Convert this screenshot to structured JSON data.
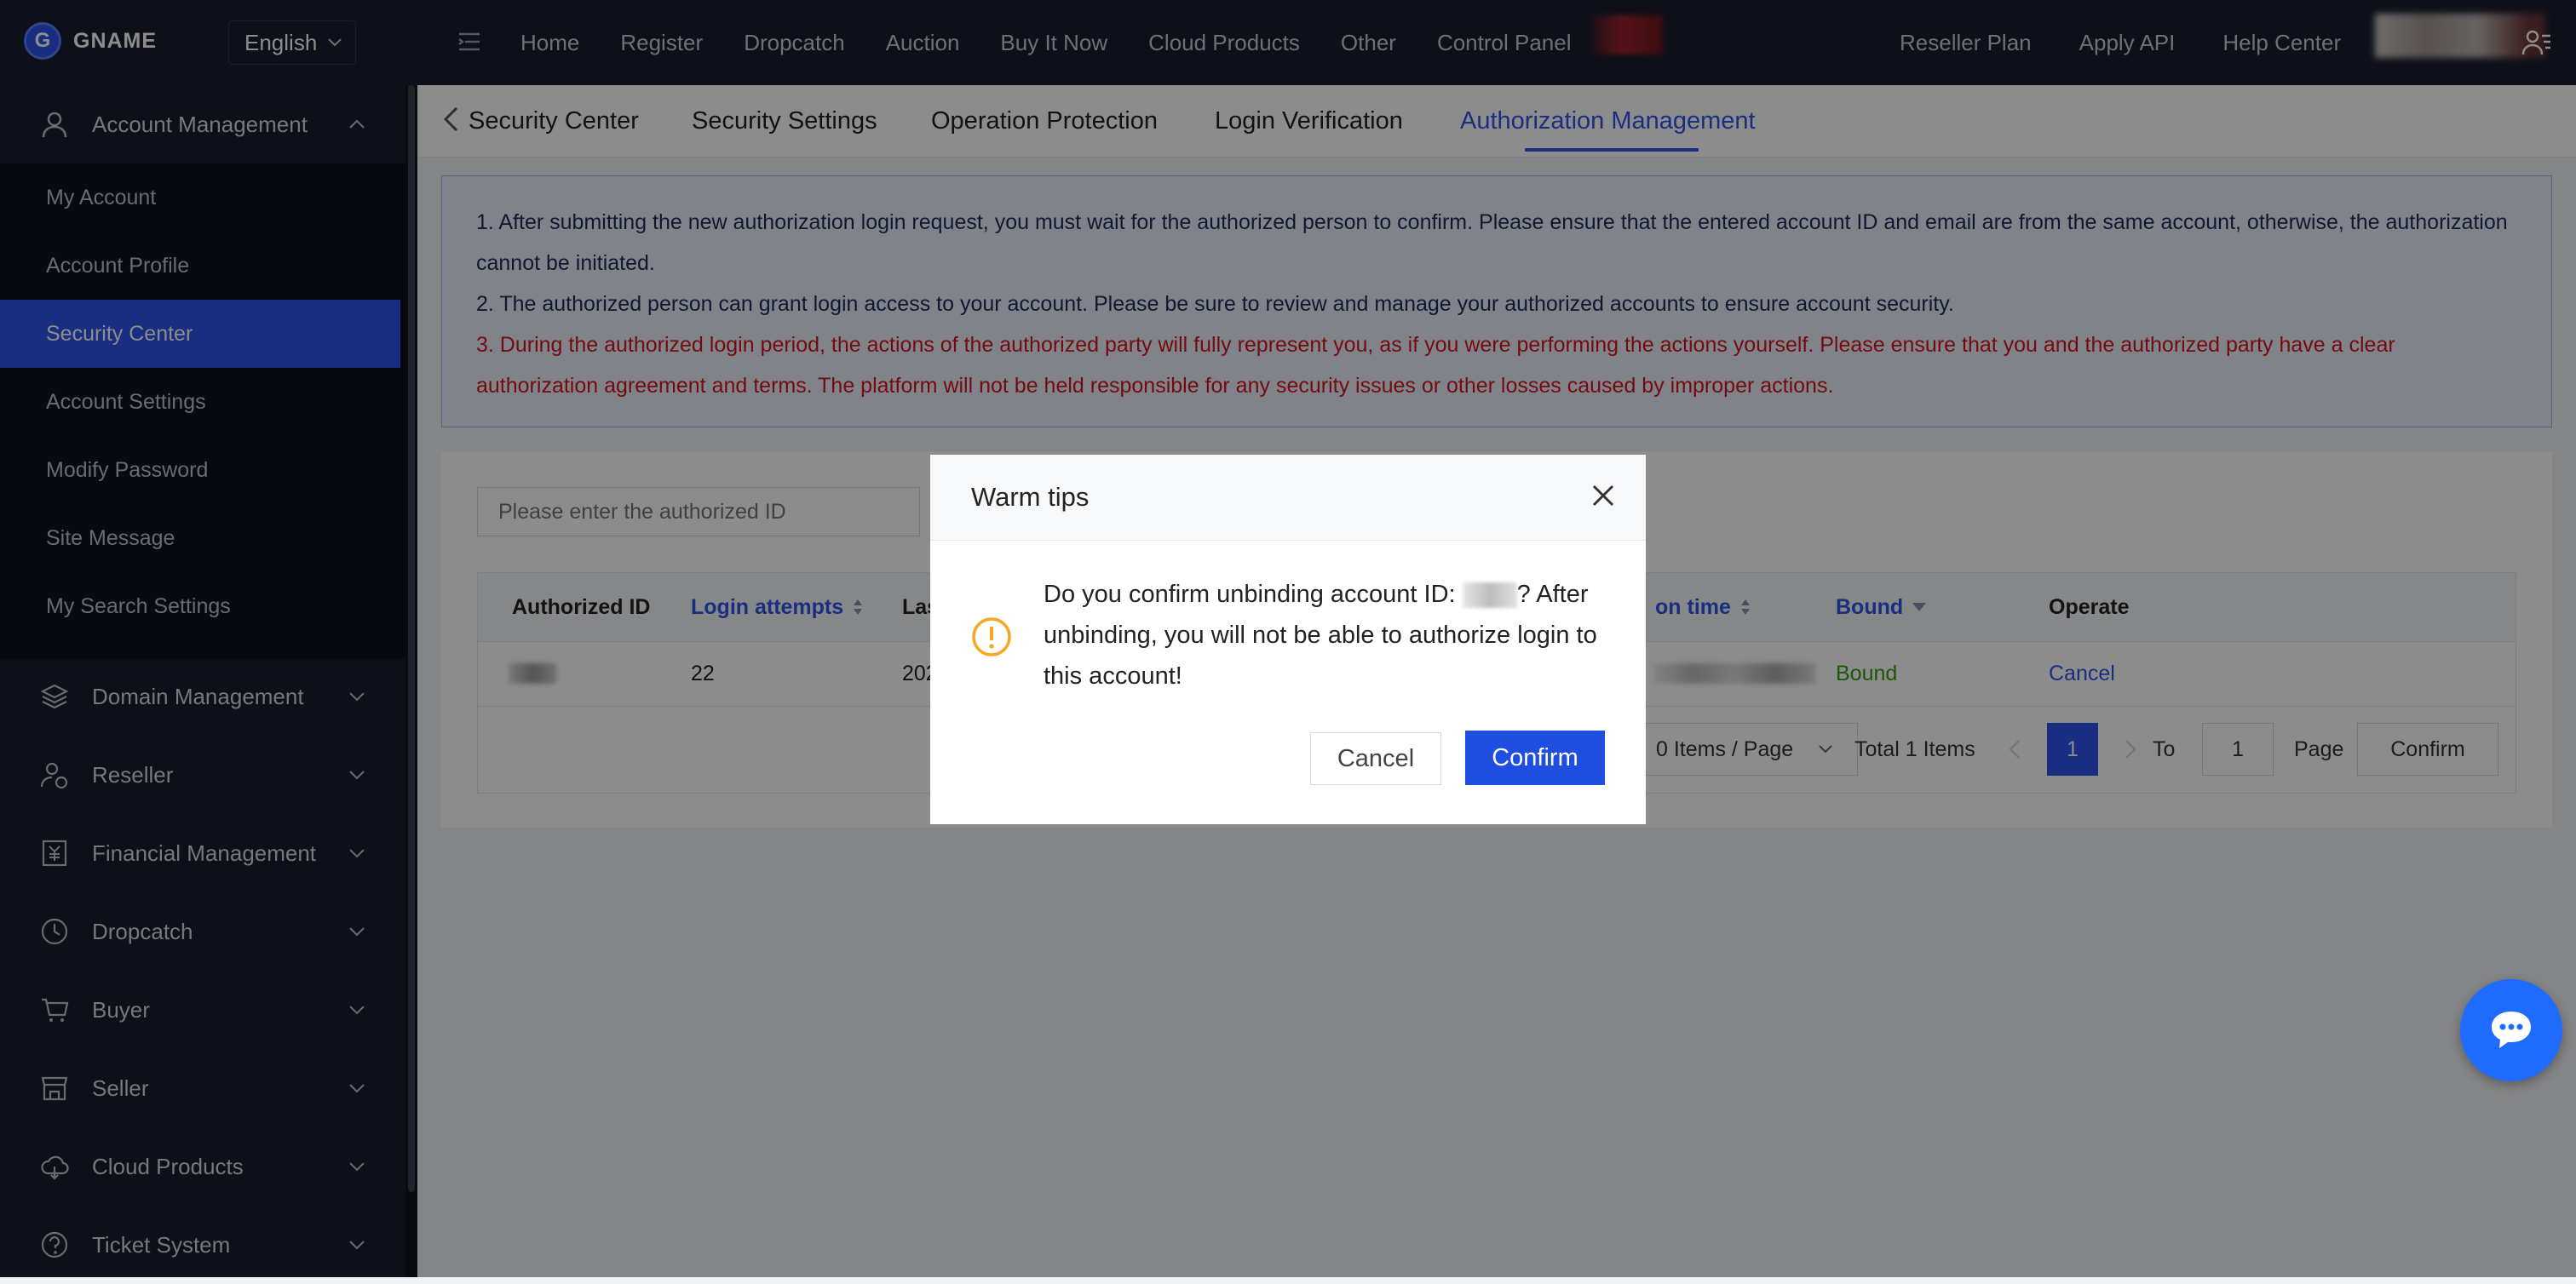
{
  "brand": {
    "name": "GNAME"
  },
  "language": {
    "selected": "English"
  },
  "topnav": {
    "items": [
      "Home",
      "Register",
      "Dropcatch",
      "Auction",
      "Buy It Now",
      "Cloud Products",
      "Other",
      "Control Panel"
    ],
    "right_items": [
      "Reseller Plan",
      "Apply API",
      "Help Center"
    ]
  },
  "sidebar": {
    "groups": [
      {
        "label": "Account Management",
        "icon": "user-icon",
        "expanded": true
      },
      {
        "label": "Domain Management",
        "icon": "layers-icon"
      },
      {
        "label": "Reseller",
        "icon": "reseller-icon"
      },
      {
        "label": "Financial Management",
        "icon": "finance-icon"
      },
      {
        "label": "Dropcatch",
        "icon": "clock-icon"
      },
      {
        "label": "Buyer",
        "icon": "cart-icon"
      },
      {
        "label": "Seller",
        "icon": "store-icon"
      },
      {
        "label": "Cloud Products",
        "icon": "cloud-icon"
      },
      {
        "label": "Ticket System",
        "icon": "question-icon"
      }
    ],
    "account_items": [
      "My Account",
      "Account Profile",
      "Security Center",
      "Account Settings",
      "Modify Password",
      "Site Message",
      "My Search Settings"
    ],
    "active_item": "Security Center"
  },
  "tabs": {
    "items": [
      "Security Center",
      "Security Settings",
      "Operation Protection",
      "Login Verification",
      "Authorization Management"
    ],
    "active": "Authorization Management"
  },
  "notice": {
    "line1": "1. After submitting the new authorization login request, you must wait for the authorized person to confirm. Please ensure that the entered account ID and email are from the same account, otherwise, the authorization cannot be initiated.",
    "line2": "2. The authorized person can grant login access to your account. Please be sure to review and manage your authorized accounts to ensure account security.",
    "line3": "3. During the authorized login period, the actions of the authorized party will fully represent you, as if you were performing the actions yourself. Please ensure that you and the authorized party have a clear authorization agreement and terms. The platform will not be held responsible for any security issues or other losses caused by improper actions."
  },
  "search": {
    "placeholder": "Please enter the authorized ID"
  },
  "table": {
    "headers": [
      "Authorized ID",
      "Login attempts",
      "Las",
      "on time",
      "Bound",
      "Operate"
    ],
    "rows": [
      {
        "login_attempts": "22",
        "last": "202",
        "bound": "Bound",
        "operate": "Cancel"
      }
    ]
  },
  "pagination": {
    "per_page": "0 Items / Page",
    "total": "Total 1 Items",
    "current_page": "1",
    "to_label": "To",
    "goto_value": "1",
    "page_label": "Page",
    "confirm_label": "Confirm"
  },
  "modal": {
    "title": "Warm tips",
    "message_before": "Do you confirm unbinding account ID: ",
    "message_after": "? After unbinding, you will not be able to authorize login to this account!",
    "cancel_label": "Cancel",
    "confirm_label": "Confirm"
  },
  "colors": {
    "primary": "#2f54eb",
    "danger": "#d4151a",
    "success": "#389e0d",
    "topbar": "#191e2e"
  }
}
